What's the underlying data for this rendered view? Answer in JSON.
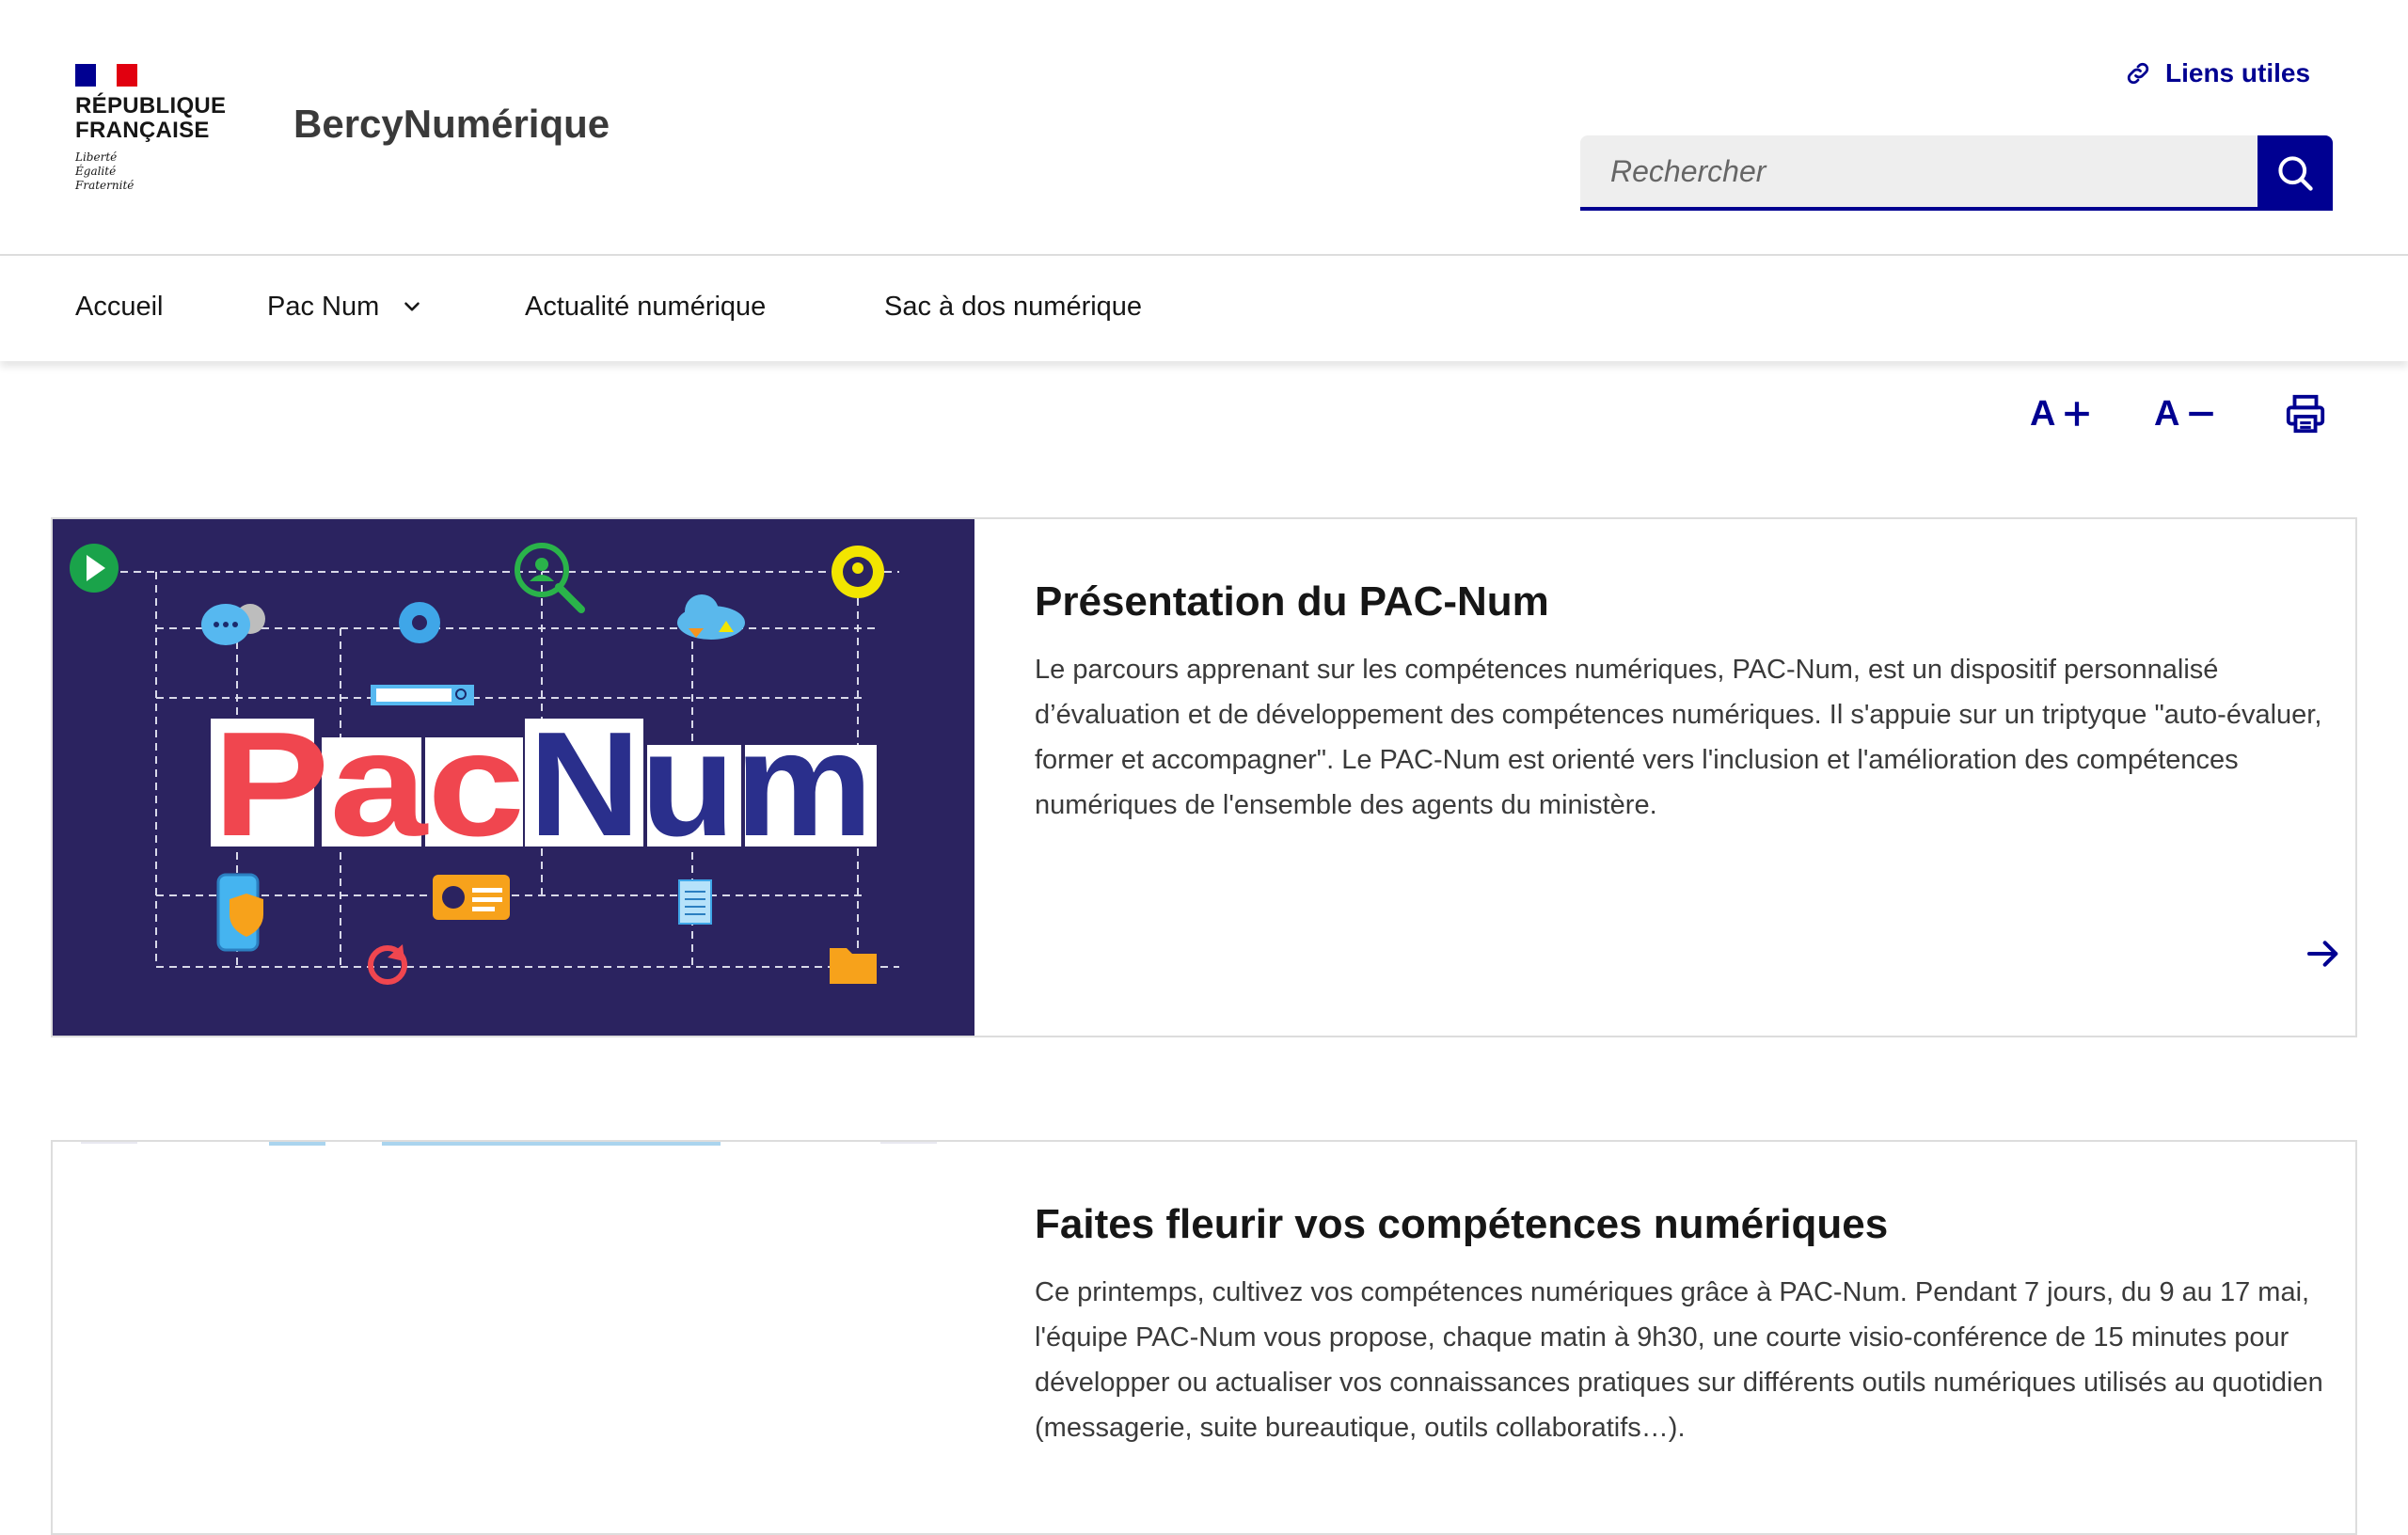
{
  "header": {
    "republique_line1": "RÉPUBLIQUE",
    "republique_line2": "FRANÇAISE",
    "devise_1": "Liberté",
    "devise_2": "Égalité",
    "devise_3": "Fraternité",
    "site_title": "BercyNumérique",
    "liens_utiles": "Liens utiles",
    "search_placeholder": "Rechercher"
  },
  "nav": {
    "items": [
      {
        "label": "Accueil"
      },
      {
        "label": "Pac Num"
      },
      {
        "label": "Actualité numérique"
      },
      {
        "label": "Sac à dos numérique"
      }
    ]
  },
  "tools": {
    "increase": "A",
    "decrease": "A"
  },
  "cards": [
    {
      "image_text_1": "Pac",
      "image_text_2": "Num",
      "title": "Présentation du PAC-Num",
      "description": "Le parcours apprenant sur les compétences numériques, PAC-Num, est un dispositif personnalisé d’évaluation et de développement des compétences numériques. Il s'appuie sur un triptyque \"auto-évaluer, former et accompagner\". Le PAC-Num est orienté vers l'inclusion et l'amélioration des compétences numériques de l'ensemble des agents du ministère."
    },
    {
      "title": "Faites fleurir vos compétences numériques",
      "description": "Ce printemps, cultivez vos compétences numériques grâce à PAC-Num. Pendant 7 jours, du 9 au 17 mai, l'équipe PAC-Num vous propose, chaque matin à 9h30, une courte visio-conférence de 15 minutes pour développer ou actualiser vos connaissances pratiques sur différents outils numériques utilisés au quotidien (messagerie, suite bureautique, outils collaboratifs…)."
    }
  ],
  "colors": {
    "primary": "#000091",
    "marianne_red": "#e1000f",
    "card_media_bg": "#2b2360",
    "pac_red": "#f0464f",
    "num_blue": "#2a2f8c"
  }
}
